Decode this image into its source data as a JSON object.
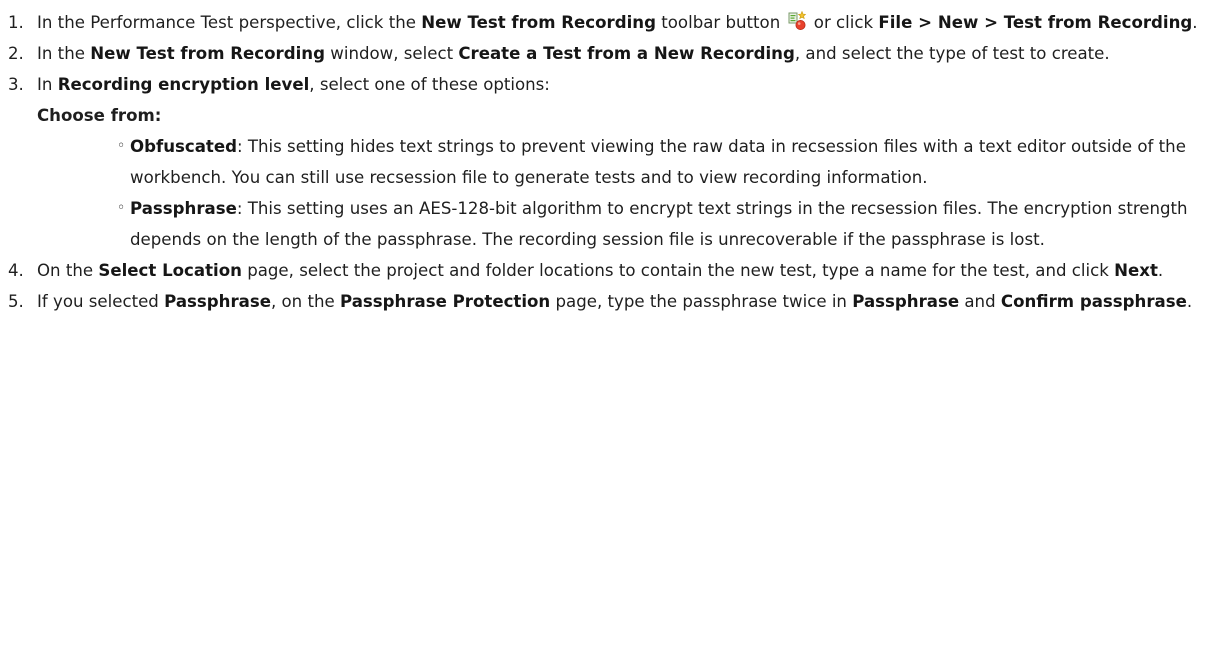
{
  "steps": [
    {
      "num": "1.",
      "t1": "In the Performance Test perspective, click the ",
      "b1": "New Test from Recording",
      "t2": " toolbar button ",
      "icon": "new-test-from-recording-icon",
      "t3": " or click ",
      "b2": "File > New > Test from Recording",
      "t4": "."
    },
    {
      "num": "2.",
      "t1": "In the ",
      "b1": "New Test from Recording",
      "t2": " window, select ",
      "b2": "Create a Test from a New Recording",
      "t3": ", and select the type of test to create."
    },
    {
      "num": "3.",
      "t1": "In ",
      "b1": "Recording encryption level",
      "t2": ", select one of these options:",
      "choose_from": "Choose from:",
      "options": [
        {
          "bullet": "◦",
          "name": "Obfuscated",
          "text": ": This setting hides text strings to prevent viewing the raw data in recsession files with a text editor outside of the workbench. You can still use recsession file to generate tests and to view recording information."
        },
        {
          "bullet": "◦",
          "name": "Passphrase",
          "text": ": This setting uses an AES-128-bit algorithm to encrypt text strings in the recsession files. The encryption strength depends on the length of the passphrase. The recording session file is unrecoverable if the passphrase is lost."
        }
      ]
    },
    {
      "num": "4.",
      "t1": "On the ",
      "b1": "Select Location",
      "t2": " page, select the project and folder locations to contain the new test, type a name for the test, and click ",
      "b2": "Next",
      "t3": "."
    },
    {
      "num": "5.",
      "t1": "If you selected ",
      "b1": "Passphrase",
      "t2": ", on the ",
      "b2": "Passphrase Protection",
      "t3": " page, type the passphrase twice in ",
      "b3": "Passphrase",
      "t4": " and ",
      "b4": "Confirm passphrase",
      "t5": "."
    }
  ],
  "colors": {
    "text": "#1f1f1f",
    "icon_red": "#e8412c",
    "icon_green": "#5aa832",
    "icon_yellow": "#f2c230"
  }
}
